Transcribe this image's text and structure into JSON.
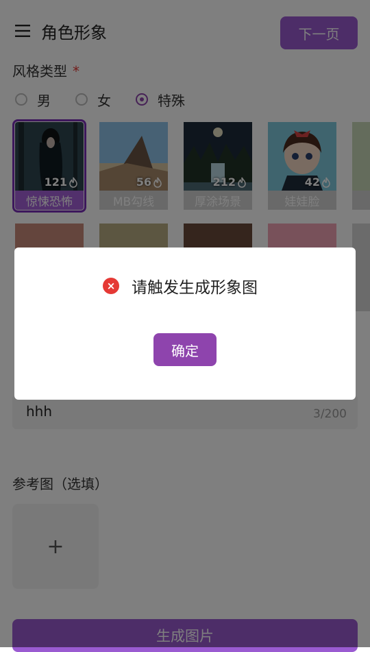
{
  "header": {
    "title": "角色形象",
    "next_label": "下一页"
  },
  "style_section": {
    "label": "风格类型",
    "required_mark": "*"
  },
  "gender_options": [
    {
      "label": "男",
      "selected": false
    },
    {
      "label": "女",
      "selected": false
    },
    {
      "label": "特殊",
      "selected": true
    }
  ],
  "style_cards": [
    {
      "label": "惊悚恐怖",
      "count": "121",
      "selected": true
    },
    {
      "label": "MB勾线",
      "count": "56",
      "selected": false
    },
    {
      "label": "厚涂场景",
      "count": "212",
      "selected": false
    },
    {
      "label": "娃娃脸",
      "count": "42",
      "selected": false
    }
  ],
  "description": {
    "value": "hhh",
    "counter": "3/200"
  },
  "reference": {
    "label": "参考图（选填）",
    "add_symbol": "+"
  },
  "generate_label": "生成图片",
  "dialog": {
    "message": "请触发生成形象图",
    "confirm_label": "确定"
  },
  "colors": {
    "accent": "#8e44ad",
    "error": "#e53935"
  }
}
